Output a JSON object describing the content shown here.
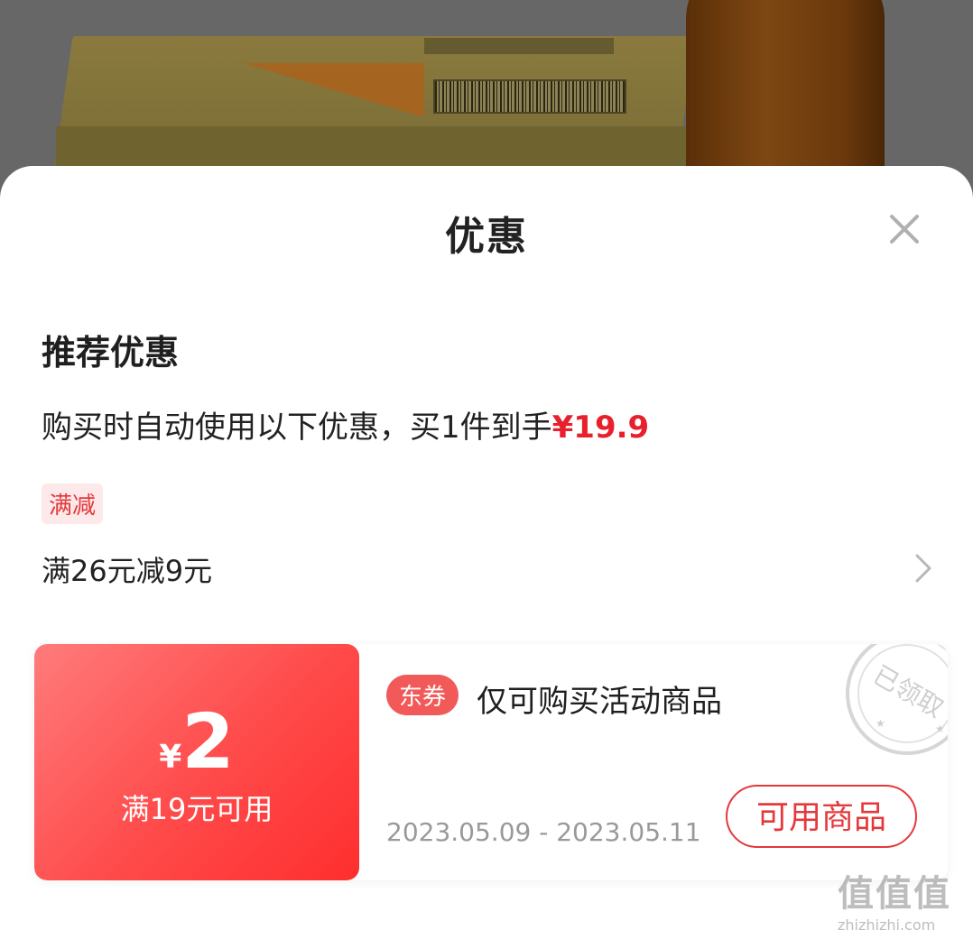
{
  "sheet": {
    "title": "优惠"
  },
  "recommend": {
    "title": "推荐优惠",
    "desc_prefix": "购买时自动使用以下优惠，买1件到手",
    "desc_price": "¥19.9"
  },
  "promotion": {
    "tag": "满减",
    "rule": "满26元减9元"
  },
  "coupon": {
    "currency": "¥",
    "amount": "2",
    "condition": "满19元可用",
    "badge": "东券",
    "description": "仅可购买活动商品",
    "date_range": "2023.05.09 - 2023.05.11",
    "button_label": "可用商品",
    "stamp_text": "已领取"
  },
  "watermark": {
    "logo": "值值值",
    "site": "zhizhizhi.com"
  },
  "colors": {
    "accent": "#e4393c",
    "coupon_gradient_start": "#ff7b7b",
    "coupon_gradient_end": "#ff2e2e"
  }
}
